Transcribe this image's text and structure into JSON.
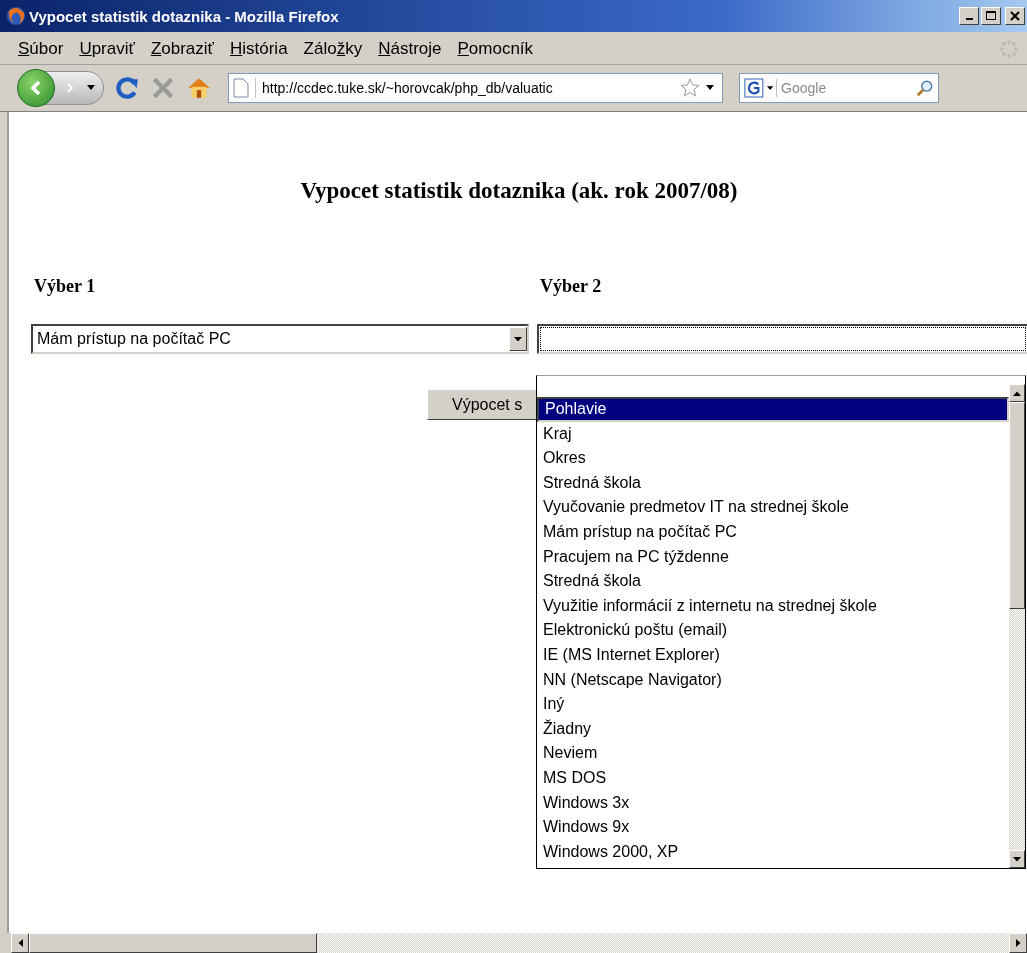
{
  "window": {
    "title": "Vypocet statistik dotaznika - Mozilla Firefox"
  },
  "menu": [
    {
      "key": "S",
      "post": "úbor"
    },
    {
      "key": "U",
      "post": "praviť"
    },
    {
      "key": "Z",
      "post": "obraziť"
    },
    {
      "key": "H",
      "post": "istória"
    },
    {
      "pre": "Zálo",
      "key": "ž",
      "post": "ky"
    },
    {
      "key": "N",
      "post": "ástroje"
    },
    {
      "key": "P",
      "post": "omocník"
    }
  ],
  "toolbar": {
    "url": "http://ccdec.tuke.sk/~horovcak/php_db/valuatic",
    "search_placeholder": "Google"
  },
  "page": {
    "heading": "Vypocet statistik dotaznika (ak. rok 2007/08)",
    "selection_1": {
      "label": "Výber 1",
      "value": "Mám prístup na počítač PC"
    },
    "selection_2": {
      "label": "Výber 2",
      "expanded": true,
      "options": [
        {
          "label": "Pohlavie",
          "selected": true
        },
        {
          "label": "Kraj",
          "selected": false
        },
        {
          "label": "Okres",
          "selected": false
        },
        {
          "label": "Stredná škola",
          "selected": false
        },
        {
          "label": "Vyučovanie predmetov IT na strednej škole",
          "selected": false
        },
        {
          "label": "Mám prístup na počítač PC",
          "selected": false
        },
        {
          "label": "Pracujem na PC týždenne",
          "selected": false
        },
        {
          "label": "Stredná škola",
          "selected": false
        },
        {
          "label": "Využitie informácií z internetu na strednej škole",
          "selected": false
        },
        {
          "label": "Elektronickú poštu (email)",
          "selected": false
        },
        {
          "label": "IE (MS Internet Explorer)",
          "selected": false
        },
        {
          "label": "NN (Netscape Navigator)",
          "selected": false
        },
        {
          "label": "Iný",
          "selected": false
        },
        {
          "label": "Žiadny",
          "selected": false
        },
        {
          "label": "Neviem",
          "selected": false
        },
        {
          "label": "MS DOS",
          "selected": false
        },
        {
          "label": "Windows 3x",
          "selected": false
        },
        {
          "label": "Windows 9x",
          "selected": false
        },
        {
          "label": "Windows 2000, XP",
          "selected": false
        }
      ]
    },
    "button": "Výpocet s"
  }
}
